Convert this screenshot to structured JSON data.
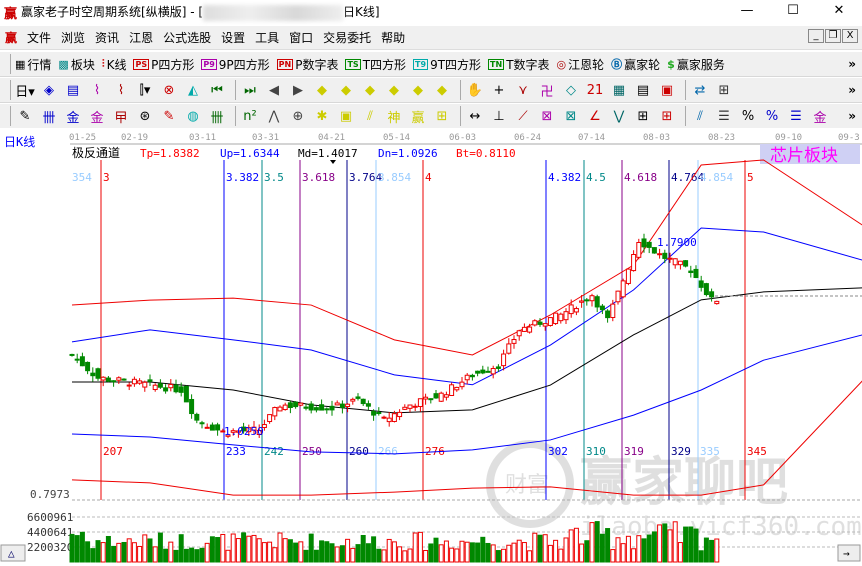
{
  "window": {
    "logo": "赢",
    "title_prefix": "赢家老子时空周期系统[纵横版] - [",
    "title_suffix": "日K线]",
    "minimize": "—",
    "maximize": "☐",
    "close": "✕"
  },
  "menu": [
    "文件",
    "浏览",
    "资讯",
    "江恩",
    "公式选股",
    "设置",
    "工具",
    "窗口",
    "交易委托",
    "帮助"
  ],
  "mdi": [
    "_",
    "❐",
    "X"
  ],
  "toolbar1": [
    {
      "icon": "▦",
      "label": "行情",
      "color": "#000"
    },
    {
      "icon": "▩",
      "label": "板块",
      "color": "#088"
    },
    {
      "icon": "⫶",
      "label": "K线",
      "color": "#c00"
    },
    {
      "icon": "PS",
      "label": "P四方形",
      "color": "#c00"
    },
    {
      "icon": "P9",
      "label": "9P四方形",
      "color": "#a0a"
    },
    {
      "icon": "PN",
      "label": "P数字表",
      "color": "#c00"
    },
    {
      "icon": "TS",
      "label": "T四方形",
      "color": "#080"
    },
    {
      "icon": "T9",
      "label": "9T四方形",
      "color": "#0aa"
    },
    {
      "icon": "TN",
      "label": "T数字表",
      "color": "#080"
    },
    {
      "icon": "◎",
      "label": "江恩轮",
      "color": "#a00"
    },
    {
      "icon": "Ⓑ",
      "label": "赢家轮",
      "color": "#06a"
    },
    {
      "icon": "$",
      "label": "赢家服务",
      "color": "#2a2"
    }
  ],
  "toolbar2": [
    "日▾",
    "◈",
    "▤",
    "⌇",
    "⌇",
    "⫿▾",
    "⊗",
    "◭",
    "⏮",
    "⏭",
    "◀",
    "▶",
    "◆",
    "◆",
    "◆",
    "◆",
    "◆",
    "◆",
    "✋",
    "+",
    "⋎",
    "卍",
    "◇",
    "21",
    "▦",
    "▤",
    "▣",
    "⇄",
    "⊞"
  ],
  "toolbar3": [
    "✎",
    "卌",
    "金",
    "金",
    "曱",
    "⊛",
    "✎",
    "◍",
    "卌",
    "n²",
    "⋀",
    "⊕",
    "✱",
    "▣",
    "⫽",
    "神",
    "赢",
    "⊞",
    "↔",
    "⊥",
    "⟋",
    "⊠",
    "⊠",
    "∠",
    "⋁",
    "⊞",
    "⊞",
    "⫽",
    "☰",
    "%",
    "%",
    "☰",
    "金"
  ],
  "chevron": "»",
  "chart": {
    "period_label": "日K线",
    "dates": [
      "01-25",
      "02-19",
      "03-11",
      "03-31",
      "04-21",
      "05-14",
      "06-03",
      "06-24",
      "07-14",
      "08-03",
      "08-23",
      "09-10",
      "09-3"
    ],
    "indicator_name": "极反通道",
    "params": [
      {
        "text": "Tp=1.8382",
        "color": "#f00"
      },
      {
        "text": "Up=1.6344",
        "color": "#00f"
      },
      {
        "text": "Md=1.4017",
        "color": "#000"
      },
      {
        "text": "Dn=1.0926",
        "color": "#00f"
      },
      {
        "text": "Bt=0.8110",
        "color": "#f00"
      }
    ],
    "sector_badge": "芯片板块",
    "cycle_lines": [
      {
        "top": "3",
        "bottom": "207",
        "color": "#e00"
      },
      {
        "top": "3.382",
        "bottom": "233",
        "color": "#00f"
      },
      {
        "top": "3.5",
        "bottom": "242",
        "color": "#088"
      },
      {
        "top": "3.618",
        "bottom": "250",
        "color": "#808"
      },
      {
        "top": "3.764",
        "bottom": "260",
        "color": "#008"
      },
      {
        "top": "3.854",
        "bottom": "266",
        "color": "#9cf"
      },
      {
        "top": "4",
        "bottom": "276",
        "color": "#e00"
      },
      {
        "top": "4.382",
        "bottom": "302",
        "color": "#00f"
      },
      {
        "top": "4.5",
        "bottom": "310",
        "color": "#088"
      },
      {
        "top": "4.618",
        "bottom": "319",
        "color": "#808"
      },
      {
        "top": "4.764",
        "bottom": "329",
        "color": "#008"
      },
      {
        "top": "4.854",
        "bottom": "335",
        "color": "#9cf"
      },
      {
        "top": "5",
        "bottom": "345",
        "color": "#e00"
      }
    ],
    "left_top_cut": "354",
    "high_label": "1.7900",
    "low_label": "1.0250",
    "price_axis_label": "0.7973",
    "volume_ticks": [
      "6600961",
      "4400641",
      "2200320"
    ],
    "watermark_main": "赢家聊吧",
    "watermark_url": "ilaoba.yicf360.com",
    "watermark_seal": "财富赢家"
  },
  "chart_data": {
    "type": "candlestick",
    "bands": {
      "x_days": [
        0,
        15,
        31,
        46,
        62,
        77,
        92,
        108,
        121,
        133,
        152
      ],
      "top": [
        1.536,
        1.556,
        1.564,
        1.536,
        1.396,
        1.335,
        1.496,
        1.697,
        2.1,
        2.12,
        1.858
      ],
      "up": [
        1.388,
        1.436,
        1.396,
        1.355,
        1.255,
        1.215,
        1.375,
        1.597,
        1.846,
        1.83,
        1.717
      ],
      "md": [
        1.226,
        1.226,
        1.194,
        1.134,
        1.102,
        1.114,
        1.214,
        1.416,
        1.557,
        1.589,
        1.605
      ],
      "dn": [
        1.017,
        1.005,
        0.973,
        0.945,
        0.937,
        0.953,
        0.993,
        1.093,
        1.194,
        1.314,
        1.416
      ],
      "bt": [
        0.832,
        0.82,
        0.771,
        0.771,
        0.783,
        0.799,
        0.804,
        0.771,
        0.771,
        0.812,
        1.231
      ]
    },
    "price_path": {
      "day": [
        0,
        5,
        15,
        21,
        24,
        29,
        36,
        40,
        50,
        55,
        60,
        65,
        71,
        77,
        82,
        86,
        94,
        100,
        103,
        109,
        113,
        119,
        123
      ],
      "close": [
        1.335,
        1.243,
        1.215,
        1.195,
        1.073,
        1.025,
        1.033,
        1.134,
        1.122,
        1.154,
        1.073,
        1.134,
        1.175,
        1.255,
        1.295,
        1.436,
        1.496,
        1.577,
        1.476,
        1.798,
        1.738,
        1.678,
        1.557
      ]
    },
    "days": 124,
    "volume_max": 7400000
  }
}
